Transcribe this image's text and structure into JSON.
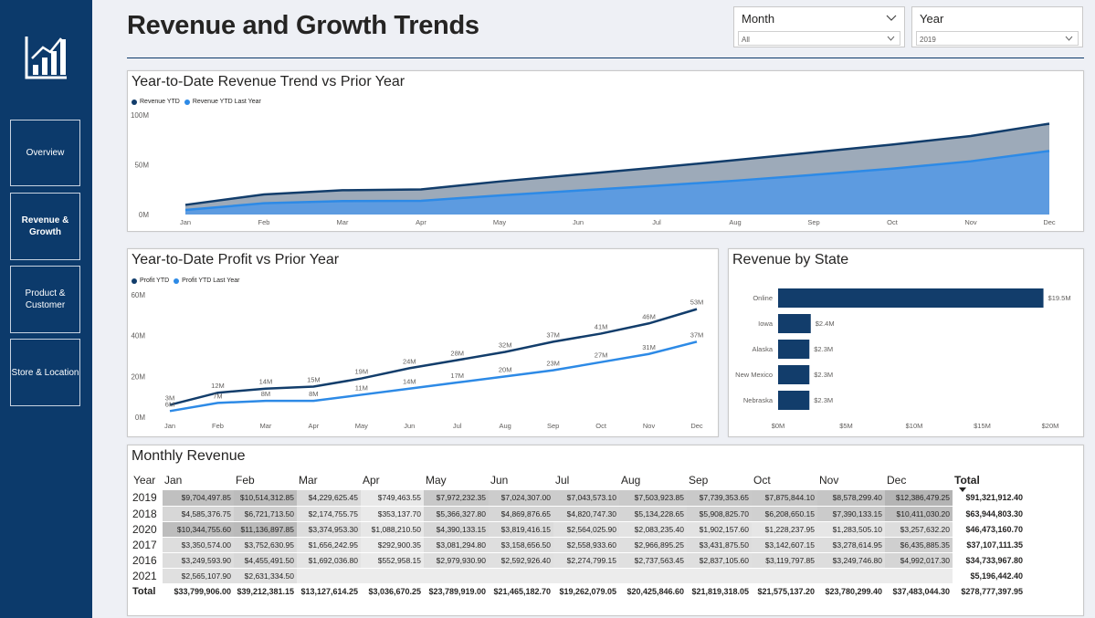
{
  "page": {
    "title": "Revenue and Growth Trends"
  },
  "nav": [
    {
      "label": "Overview"
    },
    {
      "label": "Revenue & Growth"
    },
    {
      "label": "Product & Customer"
    },
    {
      "label": "Store & Location"
    }
  ],
  "slicers": {
    "month": {
      "label": "Month",
      "value": "All"
    },
    "year": {
      "label": "Year",
      "value": "2019"
    }
  },
  "colors": {
    "sidebar": "#0c3a6b",
    "current": "#123d6b",
    "prior": "#2d8ae6",
    "area_current": "#9daab9",
    "area_prior": "#5d9be0",
    "bar": "#123d6b"
  },
  "revenue_chart": {
    "title": "Year-to-Date Revenue Trend vs Prior Year",
    "legend": [
      "Revenue YTD",
      "Revenue YTD Last Year"
    ],
    "y_ticks": [
      "100M",
      "50M",
      "0M"
    ]
  },
  "profit_chart": {
    "title": "Year-to-Date Profit vs Prior Year",
    "legend": [
      "Profit YTD",
      "Profit YTD Last Year"
    ],
    "y_ticks": [
      "60M",
      "40M",
      "20M",
      "0M"
    ]
  },
  "state_chart": {
    "title": "Revenue by State",
    "x_ticks": [
      "$0M",
      "$5M",
      "$10M",
      "$15M",
      "$20M"
    ]
  },
  "chart_data": [
    {
      "type": "area",
      "title": "Year-to-Date Revenue Trend vs Prior Year",
      "categories": [
        "Jan",
        "Feb",
        "Mar",
        "Apr",
        "May",
        "Jun",
        "Jul",
        "Aug",
        "Sep",
        "Oct",
        "Nov",
        "Dec"
      ],
      "series": [
        {
          "name": "Revenue YTD",
          "values": [
            9.7,
            20.2,
            24.4,
            25.2,
            33.2,
            40.2,
            47.2,
            54.7,
            62.5,
            70.3,
            78.9,
            91.3
          ]
        },
        {
          "name": "Revenue YTD Last Year",
          "values": [
            4.6,
            11.3,
            13.5,
            13.8,
            19.2,
            24.1,
            28.9,
            34.0,
            39.9,
            46.1,
            53.5,
            63.9
          ]
        }
      ],
      "ylim": [
        0,
        100
      ]
    },
    {
      "type": "line",
      "title": "Year-to-Date Profit vs Prior Year",
      "categories": [
        "Jan",
        "Feb",
        "Mar",
        "Apr",
        "May",
        "Jun",
        "Jul",
        "Aug",
        "Sep",
        "Oct",
        "Nov",
        "Dec"
      ],
      "series": [
        {
          "name": "Profit YTD",
          "values": [
            6,
            12,
            14,
            15,
            19,
            24,
            28,
            32,
            37,
            41,
            46,
            53
          ],
          "labels": [
            "3M",
            "12M",
            "14M",
            "15M",
            "19M",
            "24M",
            "28M",
            "32M",
            "37M",
            "41M",
            "46M",
            "53M"
          ]
        },
        {
          "name": "Profit YTD Last Year",
          "values": [
            3,
            7,
            8,
            8,
            11,
            14,
            17,
            20,
            23,
            27,
            31,
            37
          ],
          "labels": [
            "6M",
            "7M",
            "8M",
            "8M",
            "11M",
            "14M",
            "17M",
            "20M",
            "23M",
            "27M",
            "31M",
            "37M"
          ]
        }
      ],
      "ylim": [
        0,
        60
      ]
    },
    {
      "type": "bar",
      "title": "Revenue by State",
      "categories": [
        "Online",
        "Iowa",
        "Alaska",
        "New Mexico",
        "Nebraska"
      ],
      "values": [
        19.5,
        2.4,
        2.3,
        2.3,
        2.3
      ],
      "labels": [
        "$19.5M",
        "$2.4M",
        "$2.3M",
        "$2.3M",
        "$2.3M"
      ],
      "xlim": [
        0,
        20
      ]
    }
  ],
  "matrix": {
    "title": "Monthly Revenue",
    "year_header": "Year",
    "months": [
      "Jan",
      "Feb",
      "Mar",
      "Apr",
      "May",
      "Jun",
      "Jul",
      "Aug",
      "Sep",
      "Oct",
      "Nov",
      "Dec"
    ],
    "total_header": "Total",
    "rows": [
      {
        "year": "2019",
        "values": [
          "$9,704,497.85",
          "$10,514,312.85",
          "$4,229,625.45",
          "$749,463.55",
          "$7,972,232.35",
          "$7,024,307.00",
          "$7,043,573.10",
          "$7,503,923.85",
          "$7,739,353.65",
          "$7,875,844.10",
          "$8,578,299.40",
          "$12,386,479.25"
        ],
        "total": "$91,321,912.40"
      },
      {
        "year": "2018",
        "values": [
          "$4,585,376.75",
          "$6,721,713.50",
          "$2,174,755.75",
          "$353,137.70",
          "$5,366,327.80",
          "$4,869,876.65",
          "$4,820,747.30",
          "$5,134,228.65",
          "$5,908,825.70",
          "$6,208,650.15",
          "$7,390,133.15",
          "$10,411,030.20"
        ],
        "total": "$63,944,803.30"
      },
      {
        "year": "2020",
        "values": [
          "$10,344,755.60",
          "$11,136,897.85",
          "$3,374,953.30",
          "$1,088,210.50",
          "$4,390,133.15",
          "$3,819,416.15",
          "$2,564,025.90",
          "$2,083,235.40",
          "$1,902,157.60",
          "$1,228,237.95",
          "$1,283,505.10",
          "$3,257,632.20"
        ],
        "total": "$46,473,160.70"
      },
      {
        "year": "2017",
        "values": [
          "$3,350,574.00",
          "$3,752,630.95",
          "$1,656,242.95",
          "$292,900.35",
          "$3,081,294.80",
          "$3,158,656.50",
          "$2,558,933.60",
          "$2,966,895.25",
          "$3,431,875.50",
          "$3,142,607.15",
          "$3,278,614.95",
          "$6,435,885.35"
        ],
        "total": "$37,107,111.35"
      },
      {
        "year": "2016",
        "values": [
          "$3,249,593.90",
          "$4,455,491.50",
          "$1,692,036.80",
          "$552,958.15",
          "$2,979,930.90",
          "$2,592,926.40",
          "$2,274,799.15",
          "$2,737,563.45",
          "$2,837,105.60",
          "$3,119,797.85",
          "$3,249,746.80",
          "$4,992,017.30"
        ],
        "total": "$34,733,967.80"
      },
      {
        "year": "2021",
        "values": [
          "$2,565,107.90",
          "$2,631,334.50",
          "",
          "",
          "",
          "",
          "",
          "",
          "",
          "",
          "",
          ""
        ],
        "total": "$5,196,442.40"
      }
    ],
    "total_row": {
      "label": "Total",
      "values": [
        "$33,799,906.00",
        "$39,212,381.15",
        "$13,127,614.25",
        "$3,036,670.25",
        "$23,789,919.00",
        "$21,465,182.70",
        "$19,262,079.05",
        "$20,425,846.60",
        "$21,819,318.05",
        "$21,575,137.20",
        "$23,780,299.40",
        "$37,483,044.30"
      ],
      "total": "$278,777,397.95"
    }
  }
}
